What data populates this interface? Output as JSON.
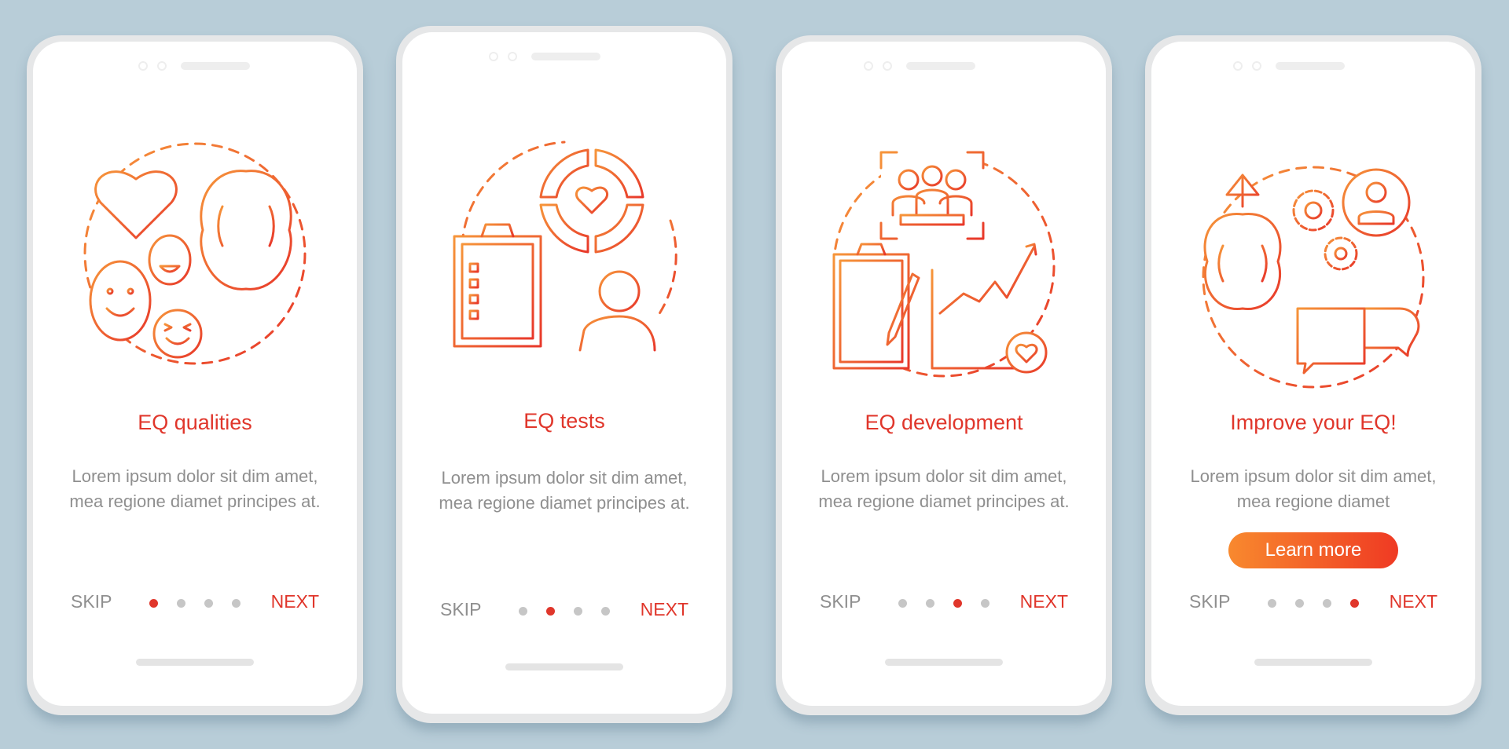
{
  "colors": {
    "background": "#b8cdd8",
    "accent_red": "#e0362b",
    "accent_orange": "#f8892e",
    "text_gray": "#8f8f8f",
    "dot_inactive": "#c6c6c6"
  },
  "screens": [
    {
      "title": "EQ qualities",
      "description": "Lorem ipsum dolor sit dim amet, mea regione diamet principes at.",
      "illustration": "heart-emoji-faces-brain-icon",
      "skip_label": "SKIP",
      "next_label": "NEXT",
      "active_page": 1,
      "total_pages": 4
    },
    {
      "title": "EQ tests",
      "description": "Lorem ipsum dolor sit dim amet, mea regione diamet principes at.",
      "illustration": "checklist-gauge-heart-person-computer-icon",
      "skip_label": "SKIP",
      "next_label": "NEXT",
      "active_page": 2,
      "total_pages": 4
    },
    {
      "title": "EQ development",
      "description": "Lorem ipsum dolor sit dim amet, mea regione diamet principes at.",
      "illustration": "team-meeting-clipboard-growth-chart-icon",
      "skip_label": "SKIP",
      "next_label": "NEXT",
      "active_page": 3,
      "total_pages": 4
    },
    {
      "title": "Improve your EQ!",
      "description": "Lorem ipsum dolor sit dim amet, mea regione diamet",
      "illustration": "brain-arrow-gears-user-chat-icon",
      "cta_label": "Learn more",
      "skip_label": "SKIP",
      "next_label": "NEXT",
      "active_page": 4,
      "total_pages": 4
    }
  ]
}
